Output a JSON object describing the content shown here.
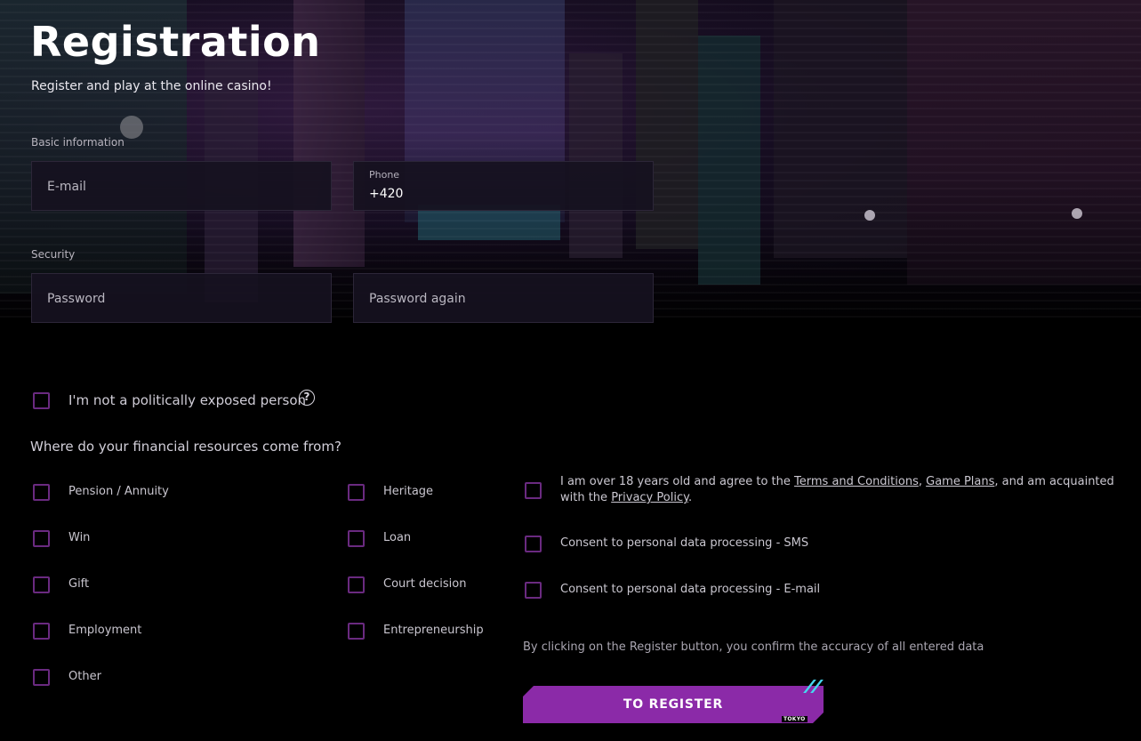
{
  "header": {
    "title": "Registration",
    "subtitle": "Register and play at the online casino!"
  },
  "sections": {
    "basic": "Basic information",
    "security": "Security"
  },
  "fields": {
    "email_placeholder": "E-mail",
    "phone_label": "Phone",
    "phone_value": "+420",
    "password_placeholder": "Password",
    "password_again_placeholder": "Password again"
  },
  "pep": {
    "label": "I'm not a politically exposed person",
    "help_icon": "?"
  },
  "financial": {
    "question": "Where do your financial resources come from?",
    "col1": [
      "Pension / Annuity",
      "Win",
      "Gift",
      "Employment",
      "Other"
    ],
    "col2": [
      "Heritage",
      "Loan",
      "Court decision",
      "Entrepreneurship"
    ]
  },
  "consents": {
    "terms_pre": "I am over 18 years old and agree to the ",
    "terms_link": "Terms and Conditions",
    "comma": ", ",
    "game_plans_link": "Game Plans",
    "terms_mid": ", and am acquainted with the ",
    "privacy_link": "Privacy Policy",
    "terms_end": ".",
    "sms": "Consent to personal data processing - SMS",
    "email": "Consent to personal data processing - E-mail"
  },
  "footer": {
    "confirm_note": "By clicking on the Register button, you confirm the accuracy of all entered data",
    "register_label": "TO REGISTER",
    "button_tag": "TOKYO"
  },
  "colors": {
    "accent": "#8b2aa8",
    "checkbox_border": "#6a2a80",
    "deco": "#45d7f0"
  }
}
